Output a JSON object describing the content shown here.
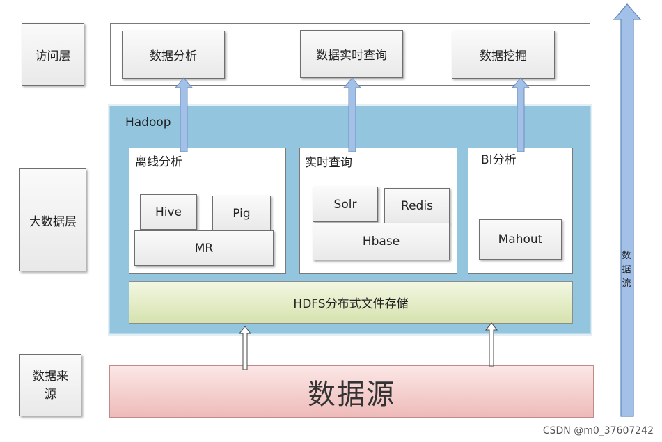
{
  "layers": {
    "access": "访问层",
    "bigdata": "大数据层",
    "source": "数据来源"
  },
  "access_layer": {
    "items": [
      "数据分析",
      "数据实时查询",
      "数据挖掘"
    ]
  },
  "hadoop": {
    "title": "Hadoop",
    "offline": {
      "title": "离线分析",
      "hive": "Hive",
      "pig": "Pig",
      "mr": "MR"
    },
    "realtime": {
      "title": "实时查询",
      "solr": "Solr",
      "redis": "Redis",
      "hbase": "Hbase"
    },
    "bi": {
      "title": "BI分析",
      "mahout": "Mahout"
    },
    "hdfs": "HDFS分布式文件存储"
  },
  "data_source": "数据源",
  "flow_label": "数据流",
  "watermark": "CSDN @m0_37607242",
  "colors": {
    "hadoop_panel": "#93c6de",
    "hdfs": "#d6e2ae",
    "source": "#eebbb9",
    "arrow_blue": "#a3c1e8"
  }
}
